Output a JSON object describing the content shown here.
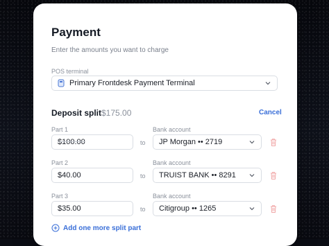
{
  "payment": {
    "title": "Payment",
    "subtitle": "Enter the amounts you want to charge",
    "terminal_label": "POS terminal",
    "terminal_value": "Primary Frontdesk Payment Terminal"
  },
  "deposit": {
    "title": "Deposit split",
    "amount": "$175.00",
    "cancel_label": "Cancel",
    "parts": [
      {
        "label": "Part 1",
        "amount": "$100.00",
        "to": "to",
        "bank_label": "Bank account",
        "bank": "JP Morgan •• 2719"
      },
      {
        "label": "Part 2",
        "amount": "$40.00",
        "to": "to",
        "bank_label": "Bank account",
        "bank": "TRUIST BANK •• 8291"
      },
      {
        "label": "Part 3",
        "amount": "$35.00",
        "to": "to",
        "bank_label": "Bank account",
        "bank": "Citigroup •• 1265"
      }
    ],
    "add_label": "Add one more split part"
  },
  "colors": {
    "accent": "#3a6fd8",
    "danger": "#f0a7a7",
    "card": "#ffffff",
    "background": "#0b0d14"
  },
  "icons": {
    "terminal": "pos-terminal-icon",
    "chevron": "chevron-down-icon",
    "trash": "trash-icon",
    "add": "plus-circle-icon"
  }
}
